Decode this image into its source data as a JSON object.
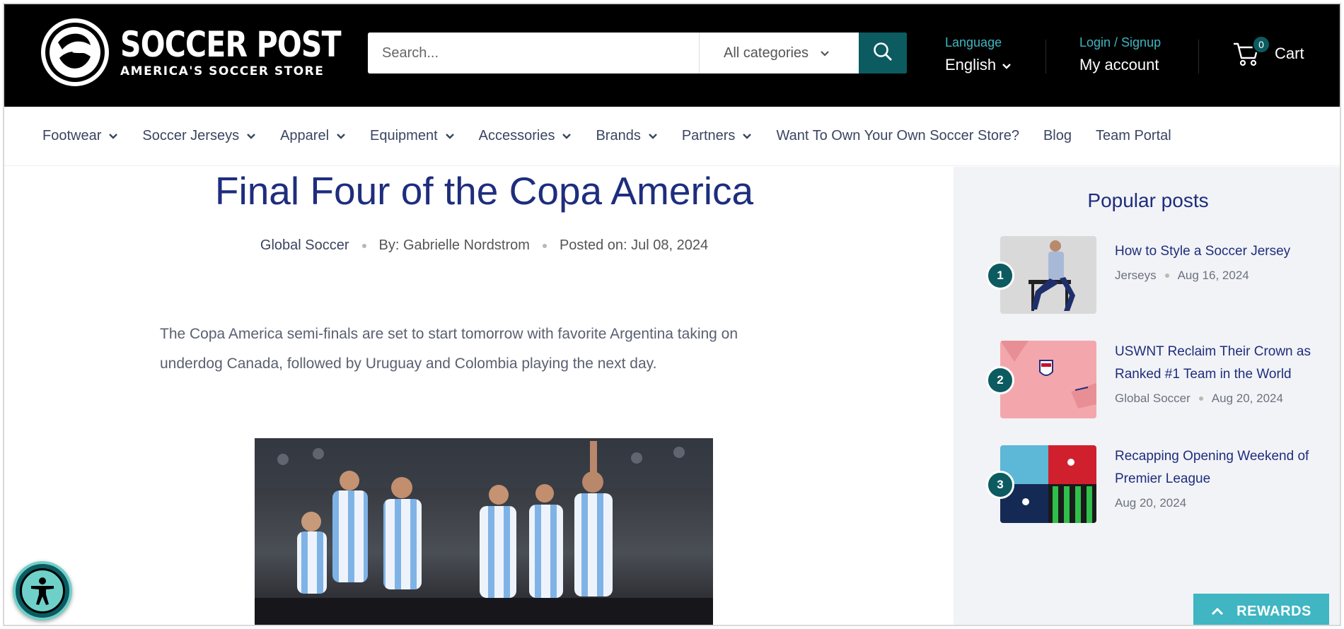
{
  "header": {
    "logo_title": "SOCCER POST",
    "logo_subtitle": "AMERICA'S SOCCER STORE",
    "search_placeholder": "Search...",
    "category_select": "All categories",
    "language_label": "Language",
    "language_value": "English",
    "login_label": "Login / Signup",
    "account_label": "My account",
    "cart_label": "Cart",
    "cart_count": "0"
  },
  "nav": {
    "items": [
      {
        "label": "Footwear",
        "has_dropdown": true
      },
      {
        "label": "Soccer Jerseys",
        "has_dropdown": true
      },
      {
        "label": "Apparel",
        "has_dropdown": true
      },
      {
        "label": "Equipment",
        "has_dropdown": true
      },
      {
        "label": "Accessories",
        "has_dropdown": true
      },
      {
        "label": "Brands",
        "has_dropdown": true
      },
      {
        "label": "Partners",
        "has_dropdown": true
      },
      {
        "label": "Want To Own Your Own Soccer Store?",
        "has_dropdown": false
      },
      {
        "label": "Blog",
        "has_dropdown": false
      },
      {
        "label": "Team Portal",
        "has_dropdown": false
      }
    ]
  },
  "article": {
    "title": "Final Four of the Copa America",
    "category": "Global Soccer",
    "author": "By: Gabrielle Nordstrom",
    "posted": "Posted on: Jul 08, 2024",
    "paragraph": "The Copa America semi-finals are set to start tomorrow with favorite Argentina taking on underdog Canada, followed by Uruguay and Colombia playing the next day."
  },
  "sidebar": {
    "title": "Popular posts",
    "posts": [
      {
        "num": "1",
        "title": "How to Style a Soccer Jersey",
        "category": "Jerseys",
        "date": "Aug 16, 2024"
      },
      {
        "num": "2",
        "title": "USWNT Reclaim Their Crown as Ranked #1 Team in the World",
        "category": "Global Soccer",
        "date": "Aug 20, 2024"
      },
      {
        "num": "3",
        "title": "Recapping Opening Weekend of Premier League",
        "category": "",
        "date": "Aug 20, 2024"
      }
    ]
  },
  "widgets": {
    "rewards_label": "REWARDS"
  },
  "colors": {
    "brand_dark": "#000000",
    "accent_teal": "#0c5b61",
    "accent_light": "#3fb6c2",
    "heading_navy": "#1e2d7d"
  }
}
